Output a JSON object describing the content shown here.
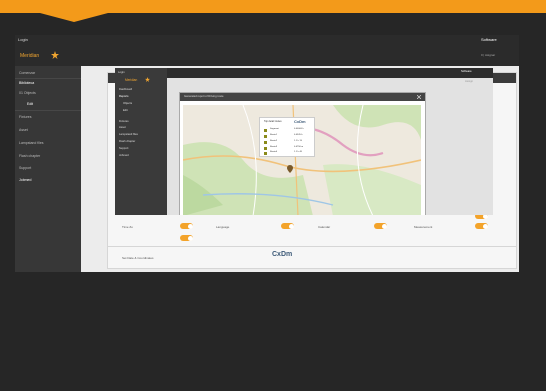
{
  "brand": {
    "accent": "#f39a1a",
    "dark": "#262626"
  },
  "outer": {
    "title": "Login",
    "logo_text": "Meridian",
    "header_right": "Software",
    "header_user": "0 | Asignar",
    "sidebar": [
      {
        "label": "Comenzar",
        "active": false
      },
      {
        "label": "Biblioteca",
        "active": true
      },
      {
        "label": "01 Objects",
        "active": false
      },
      {
        "label": "Edit",
        "active": true
      },
      {
        "label": "Fixtures",
        "active": false
      },
      {
        "label": "Asset",
        "active": false
      },
      {
        "label": "Lampstand files",
        "active": false
      },
      {
        "label": "Flash chapter",
        "active": false
      },
      {
        "label": "Support",
        "active": false
      },
      {
        "label": "Jobmed",
        "active": false
      }
    ],
    "settings_labels": [
      "Time Zo",
      "Language",
      "Calendar",
      "Measurement"
    ],
    "footer_label": "Set Date & Coordinates",
    "footer_logo": "CxDm"
  },
  "inner": {
    "title": "Login",
    "logo_text": "Meridian",
    "header_right": "Software",
    "header_user": "Assign",
    "sidebar": [
      {
        "label": "Dashboard"
      },
      {
        "label": "Reports"
      },
      {
        "label": "Objects"
      },
      {
        "label": "Edit"
      },
      {
        "label": "Fixtures"
      },
      {
        "label": "Asset"
      },
      {
        "label": "Lampstand files"
      },
      {
        "label": "Flash chapter"
      },
      {
        "label": "Support"
      },
      {
        "label": "Jobmed"
      }
    ],
    "dialog_title": "Generated report of Driving route",
    "legend_title": "Top detail routes",
    "legend_logo": "CxDm",
    "legend_rows": [
      {
        "name": "Segment",
        "value": "0.00000 h"
      },
      {
        "name": "Route1",
        "value": "0.0345 h"
      },
      {
        "name": "Route2",
        "value": "1.1 h 15"
      },
      {
        "name": "Route3",
        "value": "0.0756 m"
      },
      {
        "name": "Route4",
        "value": "1.1 h 40"
      }
    ]
  }
}
